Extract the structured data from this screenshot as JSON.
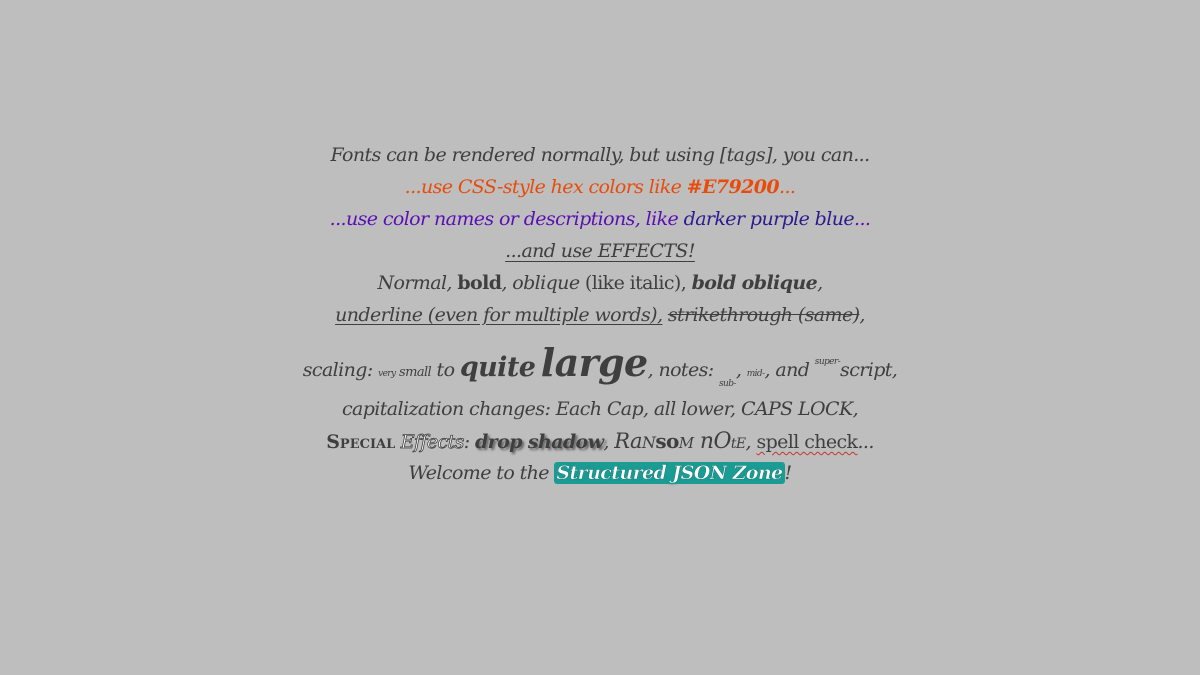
{
  "lines": {
    "l1": "Fonts can be rendered normally, but using [tags], you can...",
    "l2": "...use CSS-style hex colors like ",
    "l2_hex": "#E79200",
    "l2_end": "...",
    "l3": "...use color names or descriptions, like ",
    "l3_color": "darker purple blue",
    "l3_end": "...",
    "l4_start": "...and use ",
    "l4_effects": "EFFECTS",
    "l4_end": "!",
    "l5_normal": "Normal, ",
    "l5_bold": "bold",
    "l5_sep1": ", ",
    "l5_oblique": "oblique",
    "l5_like": " (like italic), ",
    "l5_bold_oblique": "bold oblique",
    "l5_end": ",",
    "l6_underline": "underline (even for multiple words),",
    "l6_space": " ",
    "l6_strike": "strikethrough (same)",
    "l6_end": ",",
    "l7_scaling": "scaling: ",
    "l7_very": "very",
    "l7_small": " small",
    "l7_to": " to ",
    "l7_quite": "quite",
    "l7_space": " ",
    "l7_large": "large",
    "l7_notes": ", notes: ",
    "l7_sub": "sub-",
    "l7_comma1": ", ",
    "l7_mid": "mid-",
    "l7_and": ", and ",
    "l7_super": "super-",
    "l7_script": "script,",
    "l8": "capitalization changes: Each Cap, all lower, CAPS LOCK,",
    "l9_special": "Special",
    "l9_space": " ",
    "l9_effects": "Effects",
    "l9_colon": ": ",
    "l9_shadow": "drop shadow",
    "l9_comma": ", ",
    "l9_r1": "Ra",
    "l9_r2": "N",
    "l9_r3": "so",
    "l9_r4": "M",
    "l9_r5": " nO",
    "l9_r6": "tE",
    "l9_comma2": ", ",
    "l9_spell": "spell check",
    "l9_end": "...",
    "l10_start": "Welcome to the ",
    "l10_zone": "Structured JSON Zone",
    "l10_end": "!"
  },
  "colors": {
    "background": "#bebebe",
    "text": "#3f3f3f",
    "orange": "#e74c0c",
    "purple": "#5a0fb5",
    "teal": "#1c9c94"
  }
}
